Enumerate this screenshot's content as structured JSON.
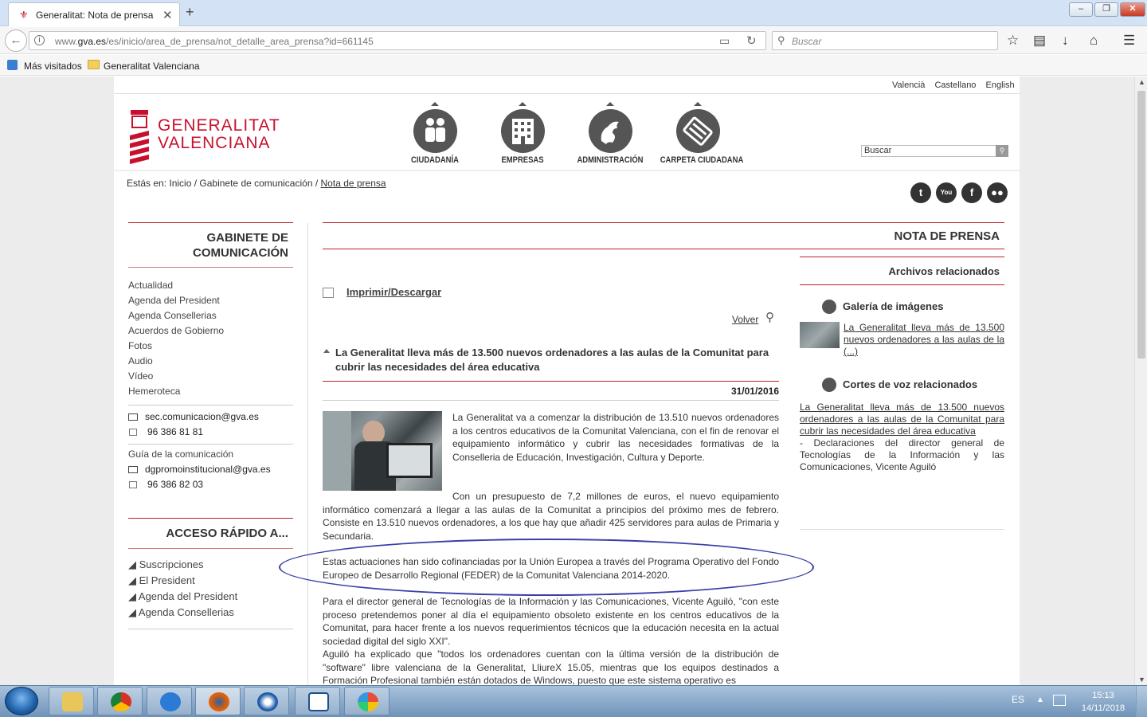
{
  "browser": {
    "tab_title": "Generalitat: Nota de prensa",
    "url_prefix": "www.",
    "url_domain": "gva.es",
    "url_path": "/es/inicio/area_de_prensa/not_detalle_area_prensa?id=661145",
    "search_placeholder": "Buscar",
    "bookmarks": [
      "Más visitados",
      "Generalitat Valenciana"
    ]
  },
  "header": {
    "languages": [
      "Valencià",
      "Castellano",
      "English"
    ],
    "logo_line1": "GENERALITAT",
    "logo_line2": "VALENCIANA",
    "nav": [
      "CIUDADANÍA",
      "EMPRESAS",
      "ADMINISTRACIÓN",
      "CARPETA CIUDADANA"
    ],
    "search_value": "Buscar"
  },
  "breadcrumb": {
    "prefix": "Estás en:",
    "items": [
      "Inicio",
      "Gabinete de comunicación",
      "Nota de prensa"
    ]
  },
  "social": [
    "twitter-icon",
    "youtube-icon",
    "facebook-icon",
    "flickr-icon"
  ],
  "sidebar": {
    "title": "GABINETE DE COMUNICACIÓN",
    "menu": [
      "Actualidad",
      "Agenda del President",
      "Agenda Consellerias",
      "Acuerdos de Gobierno",
      "Fotos",
      "Audio",
      "Vídeo",
      "Hemeroteca"
    ],
    "email1": "sec.comunicacion@gva.es",
    "phone1": "96 386 81 81",
    "guide_label": "Guía de la comunicación",
    "email2": "dgpromoinstitucional@gva.es",
    "phone2": "96 386 82 03",
    "quick_title": "ACCESO RÁPIDO A...",
    "quick_links": [
      "Suscripciones",
      "El President",
      "Agenda del President",
      "Agenda Consellerias"
    ]
  },
  "main": {
    "heading": "NOTA DE PRENSA",
    "print_label": "Imprimir/Descargar",
    "back_label": "Volver",
    "title": "La Generalitat lleva más de 13.500 nuevos ordenadores a las aulas de la Comunitat para cubrir las necesidades del área educativa",
    "date": "31/01/2016",
    "p1": "La Generalitat va a comenzar la distribución de 13.510 nuevos ordenadores a los centros educativos de la Comunitat Valenciana, con el fin de renovar el equipamiento informático y cubrir las necesidades formativas de la Conselleria de Educación, Investigación, Cultura y Deporte.",
    "p2": "Con un presupuesto de 7,2 millones de euros, el nuevo equipamiento informático comenzará a llegar a las aulas de la Comunitat a principios del próximo mes de febrero. Consiste en 13.510 nuevos ordenadores, a los que hay que añadir 425 servidores para aulas de Primaria y Secundaria.",
    "p3": "Estas actuaciones han sido cofinanciadas por la Unión Europea a través del Programa Operativo del Fondo Europeo de Desarrollo Regional (FEDER) de la Comunitat Valenciana 2014-2020.",
    "p4": "Para el director general de Tecnologías de la Información y las Comunicaciones, Vicente Aguiló, \"con este proceso pretendemos poner al día el equipamiento obsoleto existente en los centros educativos de la Comunitat, para hacer frente a los nuevos requerimientos técnicos que la educación necesita en la actual sociedad digital del siglo XXI\".",
    "p5": "Aguiló ha explicado que \"todos los ordenadores cuentan con la última versión de la distribución de \"software\" libre valenciana de la Generalitat, LliureX 15.05, mientras que los equipos destinados a Formación Profesional también están dotados de Windows, puesto que este sistema operativo es"
  },
  "related": {
    "heading": "Archivos relacionados",
    "gallery_title": "Galería de imágenes",
    "gallery_link": "La Generalitat lleva más de 13.500 nuevos ordenadores a las aulas de la (...)",
    "voice_title": "Cortes de voz relacionados",
    "voice_link": "La Generalitat lleva más de 13.500 nuevos ordenadores a las aulas de la Comunitat para cubrir las necesidades del área educativa",
    "voice_note": "- Declaraciones del director general de Tecnologías de la Información y las Comunicaciones, Vicente Aguiló"
  },
  "taskbar": {
    "lang": "ES",
    "time": "15:13",
    "date": "14/11/2018"
  }
}
